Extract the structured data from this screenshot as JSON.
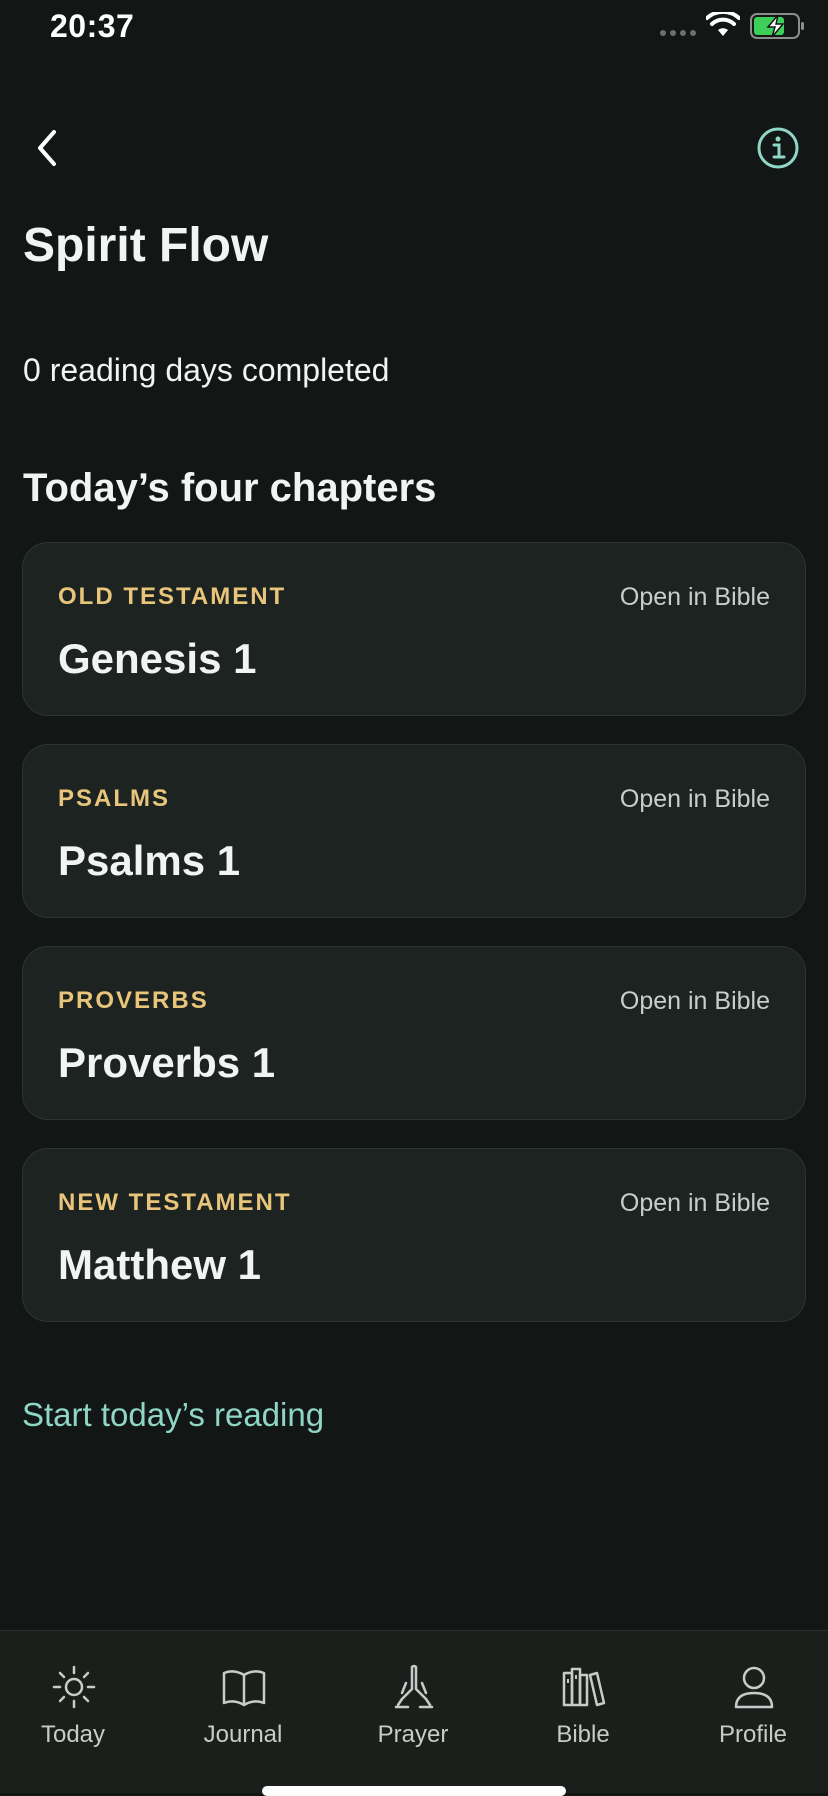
{
  "status": {
    "time": "20:37"
  },
  "header": {
    "title": "Spirit Flow",
    "back_icon": "chevron-left-icon",
    "info_icon": "info-icon"
  },
  "progress": {
    "text": "0 reading days completed"
  },
  "section": {
    "title": "Today’s four chapters"
  },
  "chapters": [
    {
      "label": "OLD TESTAMENT",
      "title": "Genesis 1",
      "action": "Open in Bible"
    },
    {
      "label": "PSALMS",
      "title": "Psalms 1",
      "action": "Open in Bible"
    },
    {
      "label": "PROVERBS",
      "title": "Proverbs 1",
      "action": "Open in Bible"
    },
    {
      "label": "NEW TESTAMENT",
      "title": "Matthew 1",
      "action": "Open in Bible"
    }
  ],
  "start": {
    "label": "Start today’s reading"
  },
  "tabs": [
    {
      "label": "Today",
      "icon": "sun-icon"
    },
    {
      "label": "Journal",
      "icon": "book-icon"
    },
    {
      "label": "Prayer",
      "icon": "praying-hands-icon"
    },
    {
      "label": "Bible",
      "icon": "bookshelf-icon"
    },
    {
      "label": "Profile",
      "icon": "person-icon"
    }
  ],
  "colors": {
    "background": "#121614",
    "card": "#1d2320",
    "accent_gold": "#e8c57a",
    "accent_teal": "#8fd6c6",
    "battery_green": "#3ecf5a"
  }
}
